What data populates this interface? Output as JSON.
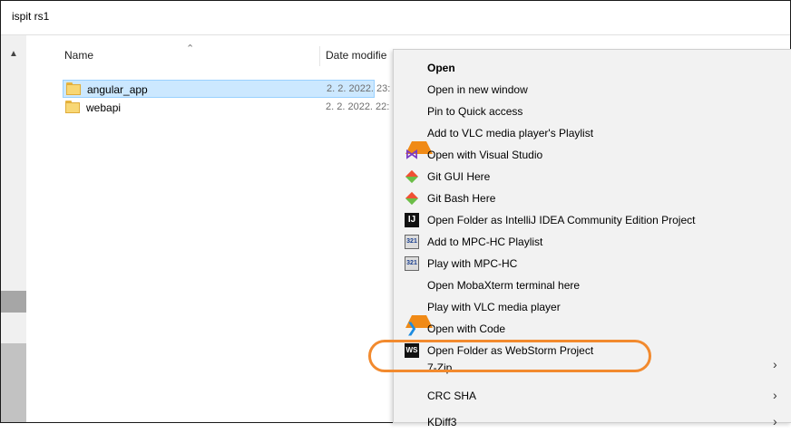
{
  "window": {
    "title": "ispit rs1"
  },
  "list": {
    "columns": {
      "name": "Name",
      "date": "Date modifie"
    },
    "rows": [
      {
        "name": "angular_app",
        "date": "2. 2. 2022. 23:",
        "selected": true
      },
      {
        "name": "webapi",
        "date": "2. 2. 2022. 22:",
        "selected": false
      }
    ]
  },
  "context_menu": {
    "items": [
      {
        "label": "Open",
        "icon": "",
        "bold": true
      },
      {
        "label": "Open in new window",
        "icon": ""
      },
      {
        "label": "Pin to Quick access",
        "icon": ""
      },
      {
        "label": "Add to VLC media player's Playlist",
        "icon": "vlc-icon"
      },
      {
        "label": "Open with Visual Studio",
        "icon": "visual-studio-icon"
      },
      {
        "label": "Git GUI Here",
        "icon": "git-icon"
      },
      {
        "label": "Git Bash Here",
        "icon": "git-icon"
      },
      {
        "label": "Open Folder as IntelliJ IDEA Community Edition Project",
        "icon": "intellij-icon",
        "icon_text": "IJ"
      },
      {
        "label": "Add to MPC-HC Playlist",
        "icon": "mpc-hc-icon",
        "icon_text": "321"
      },
      {
        "label": "Play with MPC-HC",
        "icon": "mpc-hc-icon",
        "icon_text": "321"
      },
      {
        "label": "Open MobaXterm terminal here",
        "icon": ""
      },
      {
        "label": "Play with VLC media player",
        "icon": "vlc-icon"
      },
      {
        "label": "Open with Code",
        "icon": "vscode-icon"
      },
      {
        "label": "Open Folder as WebStorm Project",
        "icon": "webstorm-icon",
        "icon_text": "WS"
      },
      {
        "label": "7-Zip",
        "icon": "",
        "submenu": true
      },
      {
        "label": "CRC SHA",
        "icon": "",
        "submenu": true
      },
      {
        "label": "KDiff3",
        "icon": "",
        "submenu": true
      }
    ]
  },
  "colors": {
    "selection": "#cce8ff",
    "highlight_ring": "#f28a2e",
    "menu_bg": "#f2f2f2"
  }
}
